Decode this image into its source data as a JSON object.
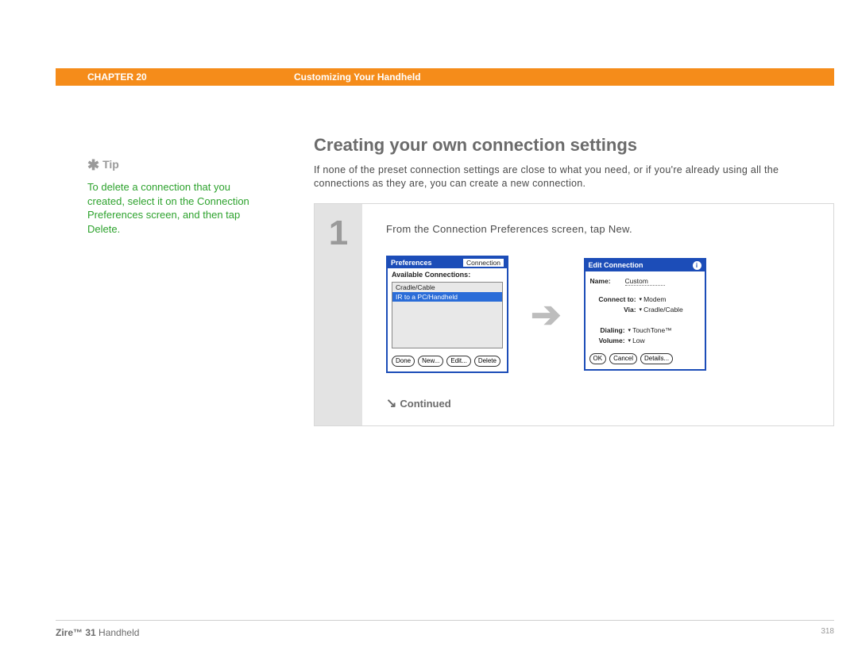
{
  "header": {
    "chapter": "CHAPTER 20",
    "title": "Customizing Your Handheld"
  },
  "sidebar": {
    "tip_label": "Tip",
    "tip_text": "To delete a connection that you created, select it on the Connection Preferences screen, and then tap Delete."
  },
  "main": {
    "heading": "Creating your own connection settings",
    "intro": "If none of the preset connection settings are close to what you need, or if you're already using all the connections as they are, you can create a new connection.",
    "step_number": "1",
    "step_instruction": "From the Connection Preferences screen, tap New.",
    "continued": "Continued"
  },
  "screen1": {
    "title": "Preferences",
    "right": "Connection",
    "subheader": "Available Connections:",
    "items": [
      "Cradle/Cable",
      "IR to a PC/Handheld"
    ],
    "buttons": {
      "done": "Done",
      "new": "New...",
      "edit": "Edit...",
      "delete": "Delete"
    }
  },
  "screen2": {
    "title": "Edit Connection",
    "name_label": "Name:",
    "name_value": "Custom",
    "connect_label": "Connect to:",
    "connect_value": "Modem",
    "via_label": "Via:",
    "via_value": "Cradle/Cable",
    "dialing_label": "Dialing:",
    "dialing_value": "TouchTone™",
    "volume_label": "Volume:",
    "volume_value": "Low",
    "buttons": {
      "ok": "OK",
      "cancel": "Cancel",
      "details": "Details..."
    }
  },
  "footer": {
    "product_bold": "Zire™ 31",
    "product_rest": " Handheld",
    "page": "318"
  }
}
